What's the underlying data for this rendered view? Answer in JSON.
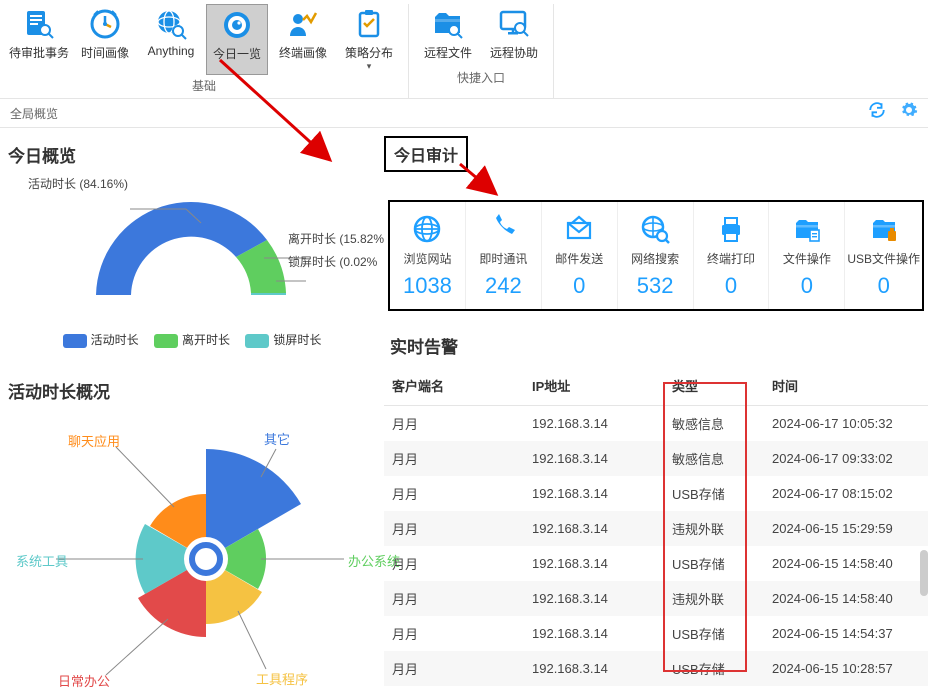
{
  "ribbon": {
    "groups": [
      {
        "title": "基础",
        "items": [
          {
            "id": "approval",
            "label": "待审批事务",
            "icon": "doc-search"
          },
          {
            "id": "time-img",
            "label": "时间画像",
            "icon": "clock"
          },
          {
            "id": "anything",
            "label": "Anything",
            "icon": "globe-search"
          },
          {
            "id": "today",
            "label": "今日一览",
            "icon": "eye",
            "active": true
          },
          {
            "id": "terminal",
            "label": "终端画像",
            "icon": "user-chart"
          },
          {
            "id": "policy",
            "label": "策略分布",
            "icon": "clipboard",
            "hasDropdown": true
          }
        ]
      },
      {
        "title": "快捷入口",
        "items": [
          {
            "id": "remote-file",
            "label": "远程文件",
            "icon": "folder-search"
          },
          {
            "id": "remote-help",
            "label": "远程协助",
            "icon": "monitor-search"
          }
        ]
      }
    ]
  },
  "breadcrumb": "全局概览",
  "left": {
    "overview_title": "今日概览",
    "donut_labels": {
      "active": "活动时长 (84.16%)",
      "leave": "离开时长 (15.82%",
      "lock": "锁屏时长 (0.02%"
    },
    "legend": {
      "active": "活动时长",
      "leave": "离开时长",
      "lock": "锁屏时长"
    },
    "activity_title": "活动时长概况",
    "pie_labels": {
      "other": "其它",
      "chat": "聊天应用",
      "system": "系统工具",
      "daily": "日常办公",
      "tools": "工具程序",
      "office": "办公系统"
    }
  },
  "colors": {
    "blue": "#3c78dc",
    "green": "#5fce5f",
    "cyan": "#5ec9c9",
    "orange": "#ff8c1a",
    "red": "#e24a4a",
    "yellow": "#f5c242",
    "accent": "#1e9fff"
  },
  "audit": {
    "head": "今日审计",
    "cards": [
      {
        "id": "browse",
        "label": "浏览网站",
        "value": "1038",
        "icon": "globe"
      },
      {
        "id": "im",
        "label": "即时通讯",
        "value": "242",
        "icon": "phone"
      },
      {
        "id": "mail",
        "label": "邮件发送",
        "value": "0",
        "icon": "mail"
      },
      {
        "id": "search",
        "label": "网络搜索",
        "value": "532",
        "icon": "net-search"
      },
      {
        "id": "print",
        "label": "终端打印",
        "value": "0",
        "icon": "printer"
      },
      {
        "id": "file",
        "label": "文件操作",
        "value": "0",
        "icon": "folder"
      },
      {
        "id": "usb",
        "label": "USB文件操作",
        "value": "0",
        "icon": "folder-usb"
      }
    ]
  },
  "alarm": {
    "title": "实时告警",
    "headers": {
      "client": "客户端名",
      "ip": "IP地址",
      "type": "类型",
      "time": "时间"
    },
    "rows": [
      {
        "client": "月月",
        "ip": "192.168.3.14",
        "type": "敏感信息",
        "time": "2024-06-17 10:05:32"
      },
      {
        "client": "月月",
        "ip": "192.168.3.14",
        "type": "敏感信息",
        "time": "2024-06-17 09:33:02"
      },
      {
        "client": "月月",
        "ip": "192.168.3.14",
        "type": "USB存储",
        "time": "2024-06-17 08:15:02"
      },
      {
        "client": "月月",
        "ip": "192.168.3.14",
        "type": "违规外联",
        "time": "2024-06-15 15:29:59"
      },
      {
        "client": "月月",
        "ip": "192.168.3.14",
        "type": "USB存储",
        "time": "2024-06-15 14:58:40"
      },
      {
        "client": "月月",
        "ip": "192.168.3.14",
        "type": "违规外联",
        "time": "2024-06-15 14:58:40"
      },
      {
        "client": "月月",
        "ip": "192.168.3.14",
        "type": "USB存储",
        "time": "2024-06-15 14:54:37"
      },
      {
        "client": "月月",
        "ip": "192.168.3.14",
        "type": "USB存储",
        "time": "2024-06-15 10:28:57"
      }
    ]
  },
  "chart_data": [
    {
      "type": "pie",
      "title": "今日概览",
      "series": [
        {
          "name": "活动时长",
          "value": 84.16,
          "color": "#3c78dc"
        },
        {
          "name": "离开时长",
          "value": 15.82,
          "color": "#5fce5f"
        },
        {
          "name": "锁屏时长",
          "value": 0.02,
          "color": "#5ec9c9"
        }
      ],
      "note": "semi-donut (upper half only)"
    },
    {
      "type": "pie",
      "title": "活动时长概况",
      "series": [
        {
          "name": "其它",
          "value": 32,
          "color": "#3c78dc"
        },
        {
          "name": "办公系统",
          "value": 10,
          "color": "#5fce5f"
        },
        {
          "name": "工具程序",
          "value": 12,
          "color": "#f5c242"
        },
        {
          "name": "日常办公",
          "value": 18,
          "color": "#e24a4a"
        },
        {
          "name": "系统工具",
          "value": 16,
          "color": "#5ec9c9"
        },
        {
          "name": "聊天应用",
          "value": 12,
          "color": "#ff8c1a"
        }
      ],
      "note": "values estimated from slice angles; donut with white center"
    }
  ]
}
